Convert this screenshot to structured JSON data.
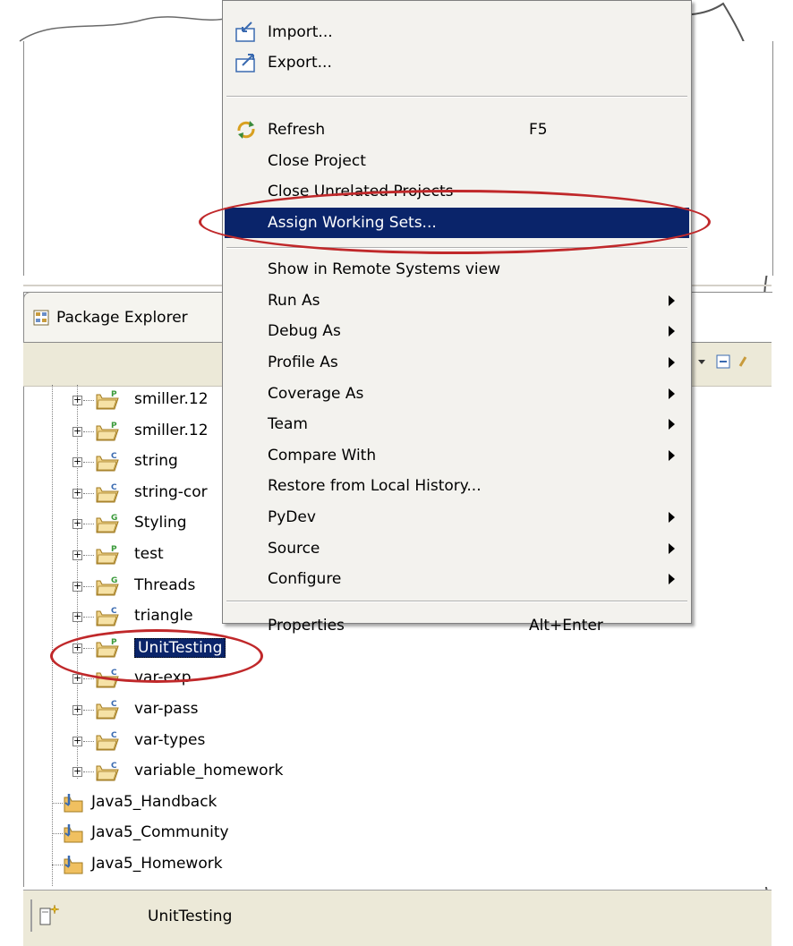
{
  "view": {
    "tab_label": "Package Explorer",
    "status_text": "UnitTesting"
  },
  "menu": {
    "import_label": "Import...",
    "export_label": "Export...",
    "refresh_label": "Refresh",
    "refresh_key": "F5",
    "close_project_label": "Close Project",
    "close_unrelated_label": "Close Unrelated Projects",
    "assign_working_sets_label": "Assign Working Sets...",
    "show_remote_label": "Show in Remote Systems view",
    "run_as_label": "Run As",
    "debug_as_label": "Debug As",
    "profile_as_label": "Profile As",
    "coverage_as_label": "Coverage As",
    "team_label": "Team",
    "compare_with_label": "Compare With",
    "restore_label": "Restore from Local History...",
    "pydev_label": "PyDev",
    "source_label": "Source",
    "configure_label": "Configure",
    "properties_label": "Properties",
    "properties_key": "Alt+Enter"
  },
  "tree": {
    "items": [
      {
        "label": "smiller.12",
        "badge": "P"
      },
      {
        "label": "smiller.12",
        "badge": "P"
      },
      {
        "label": "string",
        "badge": "C"
      },
      {
        "label": "string-cor",
        "badge": "C"
      },
      {
        "label": "Styling",
        "badge": "G"
      },
      {
        "label": "test",
        "badge": "P"
      },
      {
        "label": "Threads",
        "badge": "G"
      },
      {
        "label": "triangle",
        "badge": "C"
      },
      {
        "label": "UnitTesting",
        "badge": "P"
      },
      {
        "label": "var-exp",
        "badge": "C"
      },
      {
        "label": "var-pass",
        "badge": "C"
      },
      {
        "label": "var-types",
        "badge": "C"
      },
      {
        "label": "variable_homework",
        "badge": "C"
      }
    ],
    "working_sets": [
      {
        "label": "Java5_Handback"
      },
      {
        "label": "Java5_Community"
      },
      {
        "label": "Java5_Homework"
      }
    ]
  },
  "colors": {
    "selection": "#0a246a",
    "annotation": "#c0282a",
    "menu_bg": "#f3f2ee"
  }
}
